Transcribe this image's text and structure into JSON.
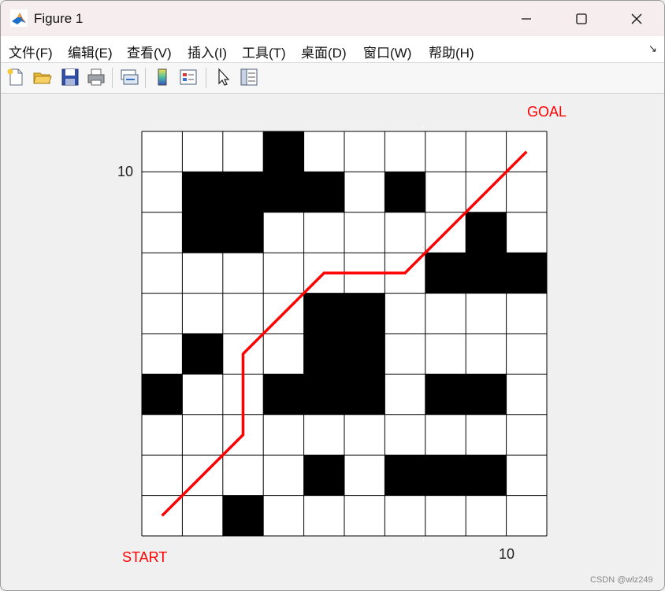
{
  "window": {
    "title": "Figure 1",
    "controls": {
      "minimize": "minimize",
      "maximize": "maximize",
      "close": "close"
    }
  },
  "menu": {
    "items": [
      "文件(F)",
      "编辑(E)",
      "查看(V)",
      "插入(I)",
      "工具(T)",
      "桌面(D)",
      "窗口(W)",
      "帮助(H)"
    ]
  },
  "toolbar": {
    "buttons": [
      "new-figure",
      "open-file",
      "save-figure",
      "print-figure",
      "link-plot",
      "insert-colorbar",
      "insert-legend",
      "edit-plot",
      "property-inspector"
    ]
  },
  "plot": {
    "goal_label": "GOAL",
    "start_label": "START",
    "x_tick": "10",
    "y_tick": "10",
    "grid": {
      "rows": 10,
      "cols": 10,
      "obstacles": [
        [
          1,
          4
        ],
        [
          2,
          2
        ],
        [
          2,
          3
        ],
        [
          2,
          4
        ],
        [
          2,
          5
        ],
        [
          2,
          7
        ],
        [
          3,
          2
        ],
        [
          3,
          3
        ],
        [
          3,
          9
        ],
        [
          4,
          8
        ],
        [
          4,
          9
        ],
        [
          4,
          10
        ],
        [
          5,
          5
        ],
        [
          5,
          6
        ],
        [
          6,
          2
        ],
        [
          6,
          5
        ],
        [
          6,
          6
        ],
        [
          7,
          1
        ],
        [
          7,
          4
        ],
        [
          7,
          5
        ],
        [
          7,
          6
        ],
        [
          7,
          8
        ],
        [
          7,
          9
        ],
        [
          9,
          5
        ],
        [
          9,
          7
        ],
        [
          9,
          8
        ],
        [
          9,
          9
        ],
        [
          10,
          3
        ]
      ]
    },
    "path": {
      "color": "#ff0000",
      "points": [
        [
          1.5,
          1.5
        ],
        [
          3.5,
          3.5
        ],
        [
          3.5,
          5.5
        ],
        [
          5.5,
          7.5
        ],
        [
          7.5,
          7.5
        ],
        [
          10.5,
          10.5
        ]
      ]
    }
  },
  "watermark": "CSDN @wlz249"
}
